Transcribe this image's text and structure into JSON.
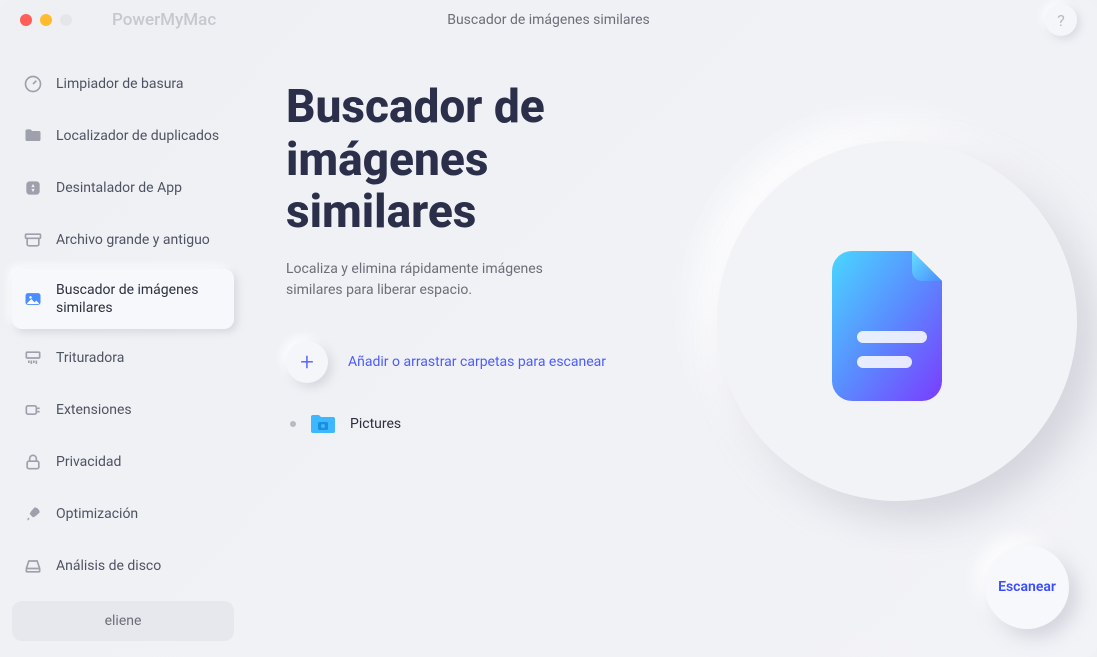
{
  "app_name": "PowerMyMac",
  "window_title": "Buscador de imágenes similares",
  "help": "?",
  "sidebar": {
    "items": [
      {
        "label": "Limpiador de basura"
      },
      {
        "label": "Localizador de duplicados"
      },
      {
        "label": "Desintalador de App"
      },
      {
        "label": "Archivo grande y antiguo"
      },
      {
        "label": "Buscador de imágenes similares"
      },
      {
        "label": "Trituradora"
      },
      {
        "label": "Extensiones"
      },
      {
        "label": "Privacidad"
      },
      {
        "label": "Optimización"
      },
      {
        "label": "Análisis de disco"
      }
    ],
    "user": "eliene"
  },
  "main": {
    "title": "Buscador de imágenes similares",
    "subtitle": "Localiza y elimina rápidamente imágenes similares para liberar espacio.",
    "add_label": "Añadir o arrastrar carpetas para escanear",
    "folder": "Pictures",
    "scan": "Escanear"
  }
}
